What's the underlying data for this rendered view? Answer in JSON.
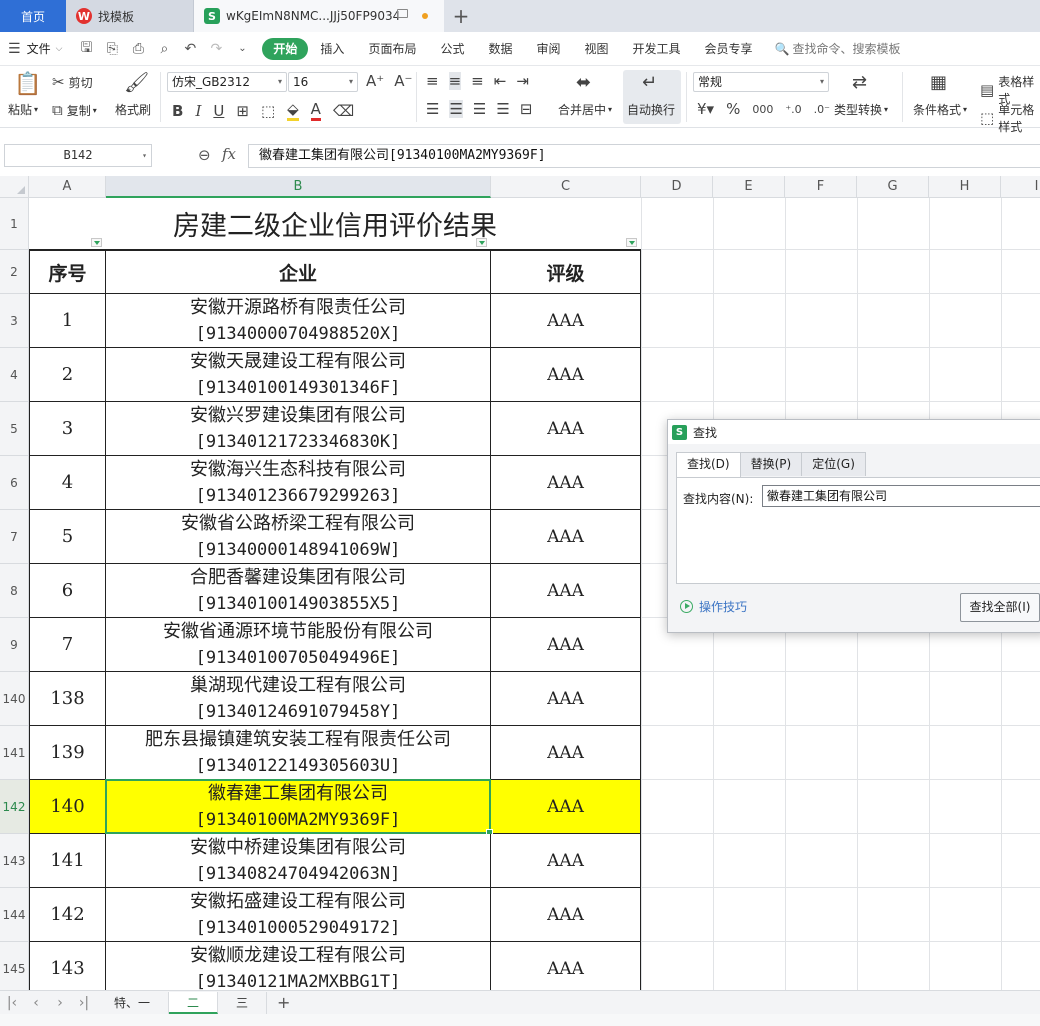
{
  "tabs": {
    "home": "首页",
    "template": "找模板",
    "document": "wKgEImN8NMC...JJj50FP9034",
    "new_tab": "+"
  },
  "menu": {
    "file": "文件",
    "items": [
      "开始",
      "插入",
      "页面布局",
      "公式",
      "数据",
      "审阅",
      "视图",
      "开发工具",
      "会员专享"
    ],
    "search": "查找命令、搜索模板"
  },
  "ribbon": {
    "paste": "粘贴",
    "cut": "剪切",
    "copy": "复制",
    "format_painter": "格式刷",
    "font_name": "仿宋_GB2312",
    "font_size": "16",
    "merge": "合并居中",
    "wrap": "自动换行",
    "number_format": "常规",
    "type_convert": "类型转换",
    "cond_format": "条件格式",
    "table_style": "表格样式",
    "cell_style": "单元格样式"
  },
  "formula_bar": {
    "cell_ref": "B142",
    "fx": "fx",
    "content": "徽春建工集团有限公司[91340100MA2MY9369F]"
  },
  "sheet": {
    "columns": [
      "A",
      "B",
      "C",
      "D",
      "E",
      "F",
      "G",
      "H",
      "I"
    ],
    "title": "房建二级企业信用评价结果",
    "headers": [
      "序号",
      "企业",
      "评级"
    ],
    "rows": [
      {
        "row": "1",
        "num": "",
        "name": "",
        "code": "",
        "grade": ""
      },
      {
        "row": "2",
        "num": "",
        "name": "",
        "code": "",
        "grade": ""
      },
      {
        "row": "3",
        "num": "1",
        "name": "安徽开源路桥有限责任公司",
        "code": "[91340000704988520X]",
        "grade": "AAA"
      },
      {
        "row": "4",
        "num": "2",
        "name": "安徽天晟建设工程有限公司",
        "code": "[91340100149301346F]",
        "grade": "AAA"
      },
      {
        "row": "5",
        "num": "3",
        "name": "安徽兴罗建设集团有限公司",
        "code": "[91340121723346830K]",
        "grade": "AAA"
      },
      {
        "row": "6",
        "num": "4",
        "name": "安徽海兴生态科技有限公司",
        "code": "[913401236679299263]",
        "grade": "AAA"
      },
      {
        "row": "7",
        "num": "5",
        "name": "安徽省公路桥梁工程有限公司",
        "code": "[91340000148941069W]",
        "grade": "AAA"
      },
      {
        "row": "8",
        "num": "6",
        "name": "合肥香馨建设集团有限公司",
        "code": "[9134010014903855X5]",
        "grade": "AAA"
      },
      {
        "row": "9",
        "num": "7",
        "name": "安徽省通源环境节能股份有限公司",
        "code": "[91340100705049496E]",
        "grade": "AAA"
      },
      {
        "row": "140",
        "num": "138",
        "name": "巢湖现代建设工程有限公司",
        "code": "[91340124691079458Y]",
        "grade": "AAA"
      },
      {
        "row": "141",
        "num": "139",
        "name": "肥东县撮镇建筑安装工程有限责任公司",
        "code": "[91340122149305603U]",
        "grade": "AAA"
      },
      {
        "row": "142",
        "num": "140",
        "name": "徽春建工集团有限公司",
        "code": "[91340100MA2MY9369F]",
        "grade": "AAA"
      },
      {
        "row": "143",
        "num": "141",
        "name": "安徽中桥建设集团有限公司",
        "code": "[91340824704942063N]",
        "grade": "AAA"
      },
      {
        "row": "144",
        "num": "142",
        "name": "安徽拓盛建设工程有限公司",
        "code": "[913401000529049172]",
        "grade": "AAA"
      },
      {
        "row": "145",
        "num": "143",
        "name": "安徽顺龙建设工程有限公司",
        "code": "[91340121MA2MXBBG1T]",
        "grade": "AAA"
      }
    ],
    "highlight_color": "#ffff00",
    "selected_row": "142"
  },
  "find_dialog": {
    "title": "查找",
    "tabs": [
      "查找(D)",
      "替换(P)",
      "定位(G)"
    ],
    "label": "查找内容(N):",
    "value": "徽春建工集团有限公司",
    "tips": "操作技巧",
    "find_all": "查找全部(I)"
  },
  "sheet_tabs": [
    "特、一",
    "二",
    "三"
  ],
  "colors": {
    "accent": "#2fa35c",
    "home_tab": "#2f6fd6"
  }
}
